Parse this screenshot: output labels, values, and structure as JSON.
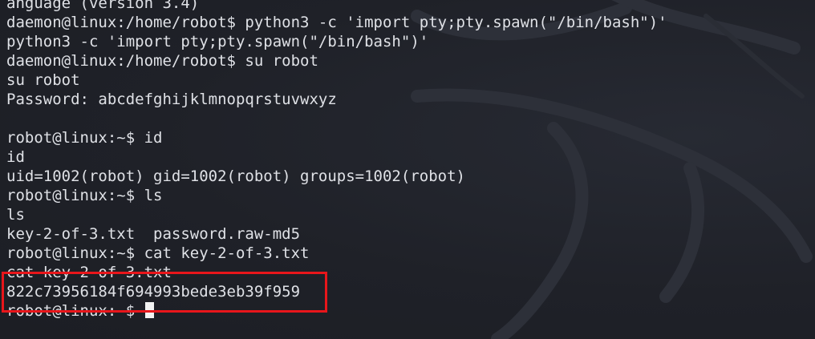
{
  "terminal": {
    "lines": [
      "anguage (version 3.4)",
      "daemon@linux:/home/robot$ python3 -c 'import pty;pty.spawn(\"/bin/bash\")'",
      "python3 -c 'import pty;pty.spawn(\"/bin/bash\")'",
      "daemon@linux:/home/robot$ su robot",
      "su robot",
      "Password: abcdefghijklmnopqrstuvwxyz",
      "",
      "robot@linux:~$ id",
      "id",
      "uid=1002(robot) gid=1002(robot) groups=1002(robot)",
      "robot@linux:~$ ls",
      "ls",
      "key-2-of-3.txt  password.raw-md5",
      "robot@linux:~$ cat key-2-of-3.txt",
      "cat key-2-of-3.txt",
      "822c73956184f694993bede3eb39f959"
    ],
    "prompt": "robot@linux:~$ ",
    "colors": {
      "background": "#1f2128",
      "text": "#dfe1e6",
      "highlight": "#e8161b",
      "cursor": "#f2f2f2"
    },
    "icons": {
      "watermark": "kali-dragon-logo"
    }
  }
}
